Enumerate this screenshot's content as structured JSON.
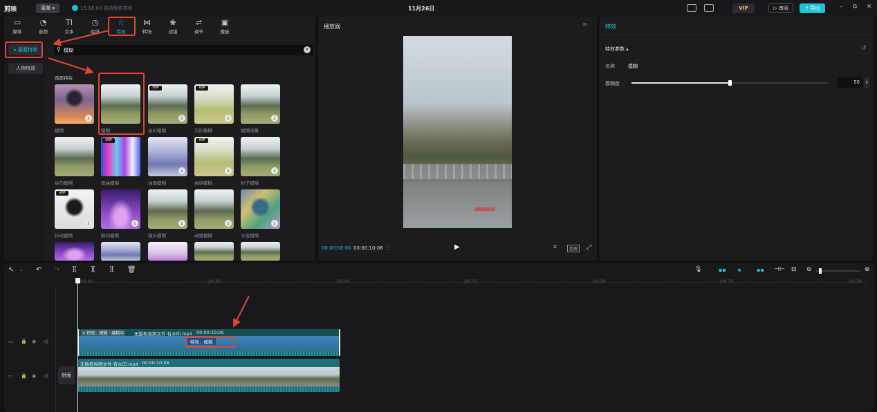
{
  "app": {
    "logo": "剪映",
    "menu": "菜单",
    "autosave": "15:16:00 自动保存本地",
    "title": "11月26日",
    "vip": "VIP",
    "review": "审阅",
    "export": "导出",
    "win_min": "–",
    "win_max": "⧉",
    "win_close": "✕"
  },
  "toolbar": {
    "items": [
      {
        "label": "媒体",
        "icon": "media-icon",
        "glyph": "▭"
      },
      {
        "label": "音频",
        "icon": "audio-icon",
        "glyph": "◔"
      },
      {
        "label": "文本",
        "icon": "text-icon",
        "glyph": "TI"
      },
      {
        "label": "贴纸",
        "icon": "sticker-icon",
        "glyph": "◷"
      },
      {
        "label": "特效",
        "icon": "effects-icon",
        "glyph": "☆",
        "active": true
      },
      {
        "label": "转场",
        "icon": "transition-icon",
        "glyph": "⋈"
      },
      {
        "label": "滤镜",
        "icon": "filter-icon",
        "glyph": "❀"
      },
      {
        "label": "调节",
        "icon": "adjust-icon",
        "glyph": "⇌"
      },
      {
        "label": "模板",
        "icon": "template-icon",
        "glyph": "▣"
      }
    ]
  },
  "categories": {
    "screen_effects": "▸ 画面特效",
    "character_effects": "人物特效"
  },
  "search": {
    "value": "模糊",
    "clear": "✕"
  },
  "effects": {
    "section_title": "画面特效",
    "items": [
      {
        "label": "模糊",
        "vip": false,
        "dl": true,
        "style": "a"
      },
      {
        "label": "模糊",
        "vip": false,
        "dl": false,
        "style": "b"
      },
      {
        "label": "迷幻模糊",
        "vip": true,
        "dl": true,
        "style": "b"
      },
      {
        "label": "方形模糊",
        "vip": true,
        "dl": true,
        "style": "c"
      },
      {
        "label": "模糊闭幕",
        "vip": false,
        "dl": true,
        "style": "b"
      },
      {
        "label": "纵向模糊",
        "vip": false,
        "dl": false,
        "style": "b"
      },
      {
        "label": "扭曲模糊",
        "vip": true,
        "dl": false,
        "style": "d"
      },
      {
        "label": "油画模糊",
        "vip": false,
        "dl": true,
        "style": "e"
      },
      {
        "label": "曲径模糊",
        "vip": true,
        "dl": true,
        "style": "c"
      },
      {
        "label": "粒子模糊",
        "vip": false,
        "dl": true,
        "style": "b"
      },
      {
        "label": "抖动模糊",
        "vip": true,
        "dl": true,
        "style": "f"
      },
      {
        "label": "瞬间模糊",
        "vip": false,
        "dl": true,
        "style": "g"
      },
      {
        "label": "镜头模糊",
        "vip": false,
        "dl": true,
        "style": "b"
      },
      {
        "label": "动感模糊",
        "vip": false,
        "dl": true,
        "style": "b"
      },
      {
        "label": "水波模糊",
        "vip": false,
        "dl": true,
        "style": "h"
      },
      {
        "label": "",
        "vip": false,
        "dl": false,
        "style": "g"
      },
      {
        "label": "",
        "vip": false,
        "dl": false,
        "style": "e"
      },
      {
        "label": "",
        "vip": false,
        "dl": false,
        "style": "i"
      },
      {
        "label": "",
        "vip": false,
        "dl": false,
        "style": "b"
      },
      {
        "label": "",
        "vip": false,
        "dl": false,
        "style": "b"
      }
    ]
  },
  "player": {
    "title": "播放器",
    "time_current": "00:00:00:00",
    "time_total": "00:00:10:06",
    "ratio": "比例"
  },
  "properties": {
    "title": "特效",
    "section": "特效参数",
    "name_label": "名称",
    "name_value": "模糊",
    "degree_label": "模糊度",
    "degree_value": "50",
    "degree_fraction": 0.5
  },
  "timeline": {
    "ruler": [
      "00:00",
      "00:05",
      "00:10",
      "00:15",
      "00:20",
      "00:25",
      "00:30"
    ],
    "clip1": {
      "effect_tag": "特效：模糊",
      "editing": "编辑中",
      "filename": "无版权视频文件 有水印.mp4",
      "duration": "00:00:10:06",
      "badge": "特效：模糊"
    },
    "clip2": {
      "filename": "无版权视频文件 有水印.mp4",
      "duration": "00:00:10:06"
    },
    "cover": "封面"
  },
  "colors": {
    "accent": "#1fc3d8",
    "highlight": "#e2472d",
    "clip": "#1f6e78"
  }
}
